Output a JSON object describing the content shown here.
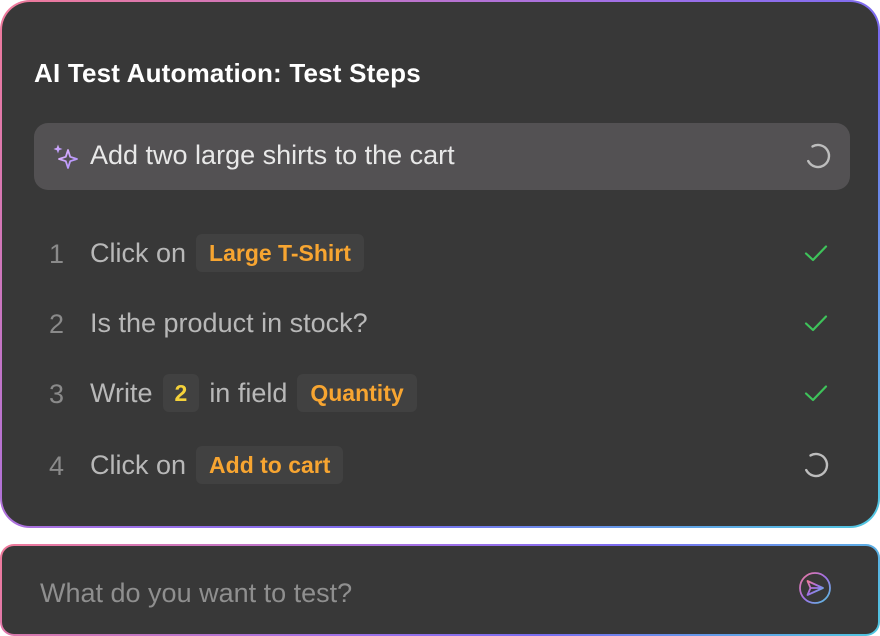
{
  "panel": {
    "title": "AI Test Automation: Test Steps",
    "prompt": "Add two large shirts to the cart",
    "prompt_icon": "sparkle-icon",
    "prompt_status": "loading"
  },
  "steps": [
    {
      "num": "1",
      "parts": [
        {
          "type": "text",
          "value": "Click on"
        },
        {
          "type": "chip",
          "value": "Large T-Shirt"
        }
      ],
      "status": "done"
    },
    {
      "num": "2",
      "parts": [
        {
          "type": "text",
          "value": "Is the product in stock?"
        }
      ],
      "status": "done"
    },
    {
      "num": "3",
      "parts": [
        {
          "type": "text",
          "value": "Write"
        },
        {
          "type": "value",
          "value": "2"
        },
        {
          "type": "text",
          "value": "in field"
        },
        {
          "type": "chip",
          "value": "Quantity"
        }
      ],
      "status": "done"
    },
    {
      "num": "4",
      "parts": [
        {
          "type": "text",
          "value": "Click on"
        },
        {
          "type": "chip",
          "value": "Add to cart"
        }
      ],
      "status": "loading"
    }
  ],
  "input": {
    "placeholder": "What do you want to test?",
    "value": ""
  },
  "colors": {
    "background": "#383838",
    "prompt_bar": "#535153",
    "chip_text": "#f7a531",
    "value_chip_text": "#f5d23a",
    "check": "#3ec35a",
    "sparkle": "#c8a8ff"
  }
}
